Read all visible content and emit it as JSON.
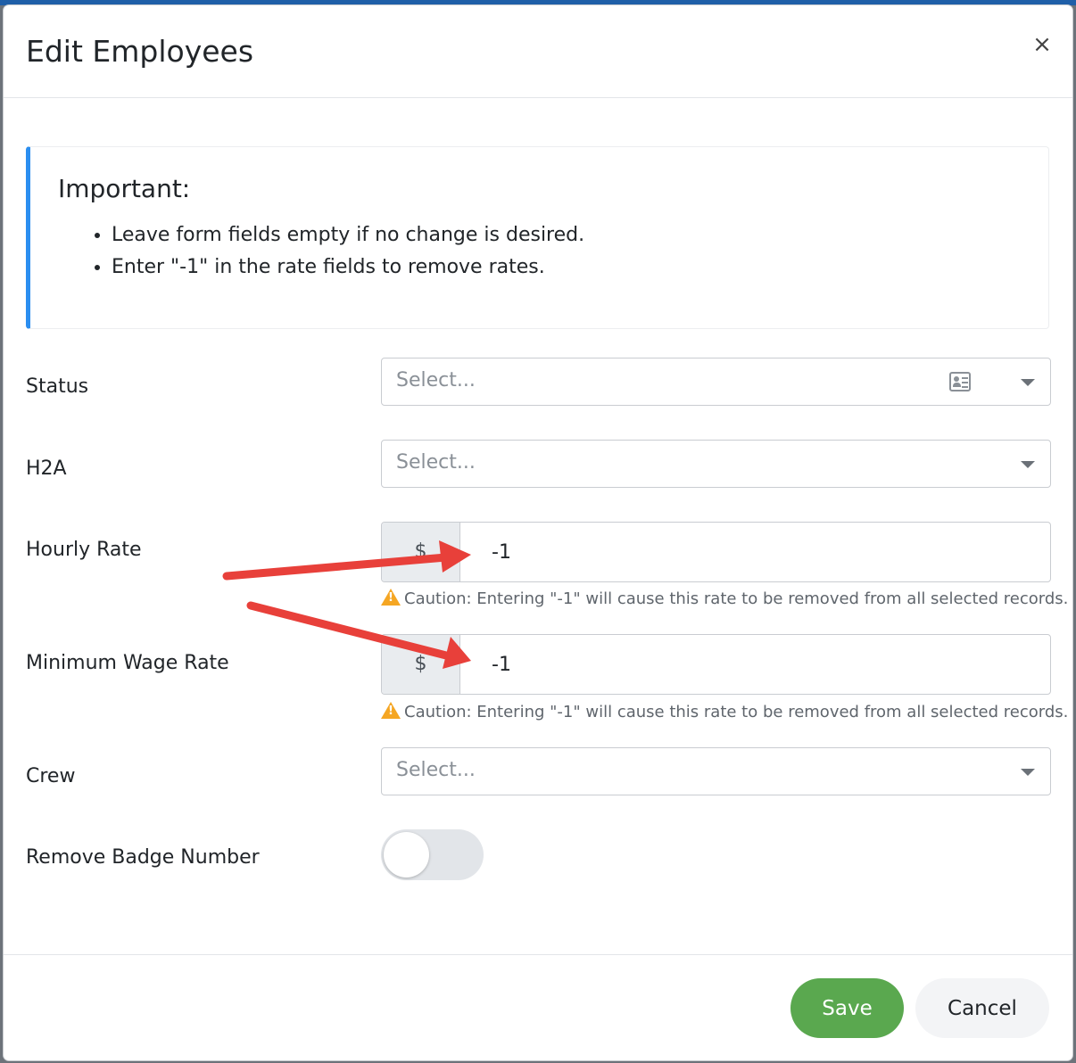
{
  "modal": {
    "title": "Edit Employees",
    "close_label": "×"
  },
  "callout": {
    "title": "Important:",
    "items": [
      "Leave form fields empty if no change is desired.",
      "Enter \"-1\" in the rate fields to remove rates."
    ]
  },
  "fields": {
    "status": {
      "label": "Status",
      "placeholder": "Select..."
    },
    "h2a": {
      "label": "H2A",
      "placeholder": "Select..."
    },
    "hourly_rate": {
      "label": "Hourly Rate",
      "prefix": "$",
      "value": "-1",
      "caution": "Caution: Entering \"-1\" will cause this rate to be removed from all selected records."
    },
    "minimum_wage_rate": {
      "label": "Minimum Wage Rate",
      "prefix": "$",
      "value": "-1",
      "caution": "Caution: Entering \"-1\" will cause this rate to be removed from all selected records."
    },
    "crew": {
      "label": "Crew",
      "placeholder": "Select..."
    },
    "remove_badge_number": {
      "label": "Remove Badge Number",
      "on": false
    }
  },
  "footer": {
    "save_label": "Save",
    "cancel_label": "Cancel"
  },
  "colors": {
    "callout_accent": "#2b8ef0",
    "save_button": "#5aa84f",
    "warning": "#f5a623",
    "annotation_arrow": "#e8403a"
  },
  "icons": {
    "close": "close-icon",
    "status_card": "contact-card-icon",
    "dropdown": "chevron-down-icon",
    "warning": "warning-icon"
  }
}
